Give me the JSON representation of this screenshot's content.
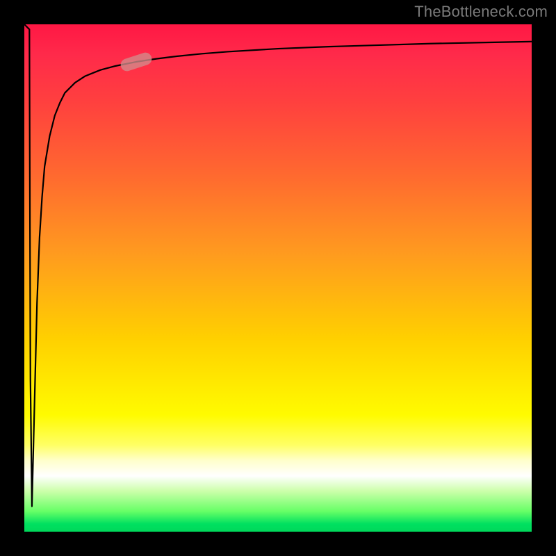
{
  "watermark": "TheBottleneck.com",
  "colors": {
    "frame": "#000000",
    "gradient_top": "#ff1744",
    "gradient_mid1": "#ff9a1f",
    "gradient_mid2": "#fffb00",
    "gradient_white": "#ffffff",
    "gradient_bottom": "#00d85a",
    "curve": "#000000",
    "marker": "rgba(210,140,140,0.78)"
  },
  "chart_data": {
    "type": "line",
    "title": "",
    "xlabel": "",
    "ylabel": "",
    "xlim": [
      0,
      100
    ],
    "ylim": [
      0,
      100
    ],
    "grid": false,
    "legend": false,
    "series": [
      {
        "name": "bottleneck-curve",
        "x": [
          0,
          1,
          1.2,
          1.5,
          2,
          2.5,
          3,
          3.5,
          4,
          5,
          6,
          7,
          8,
          10,
          12,
          15,
          18,
          22,
          26,
          30,
          35,
          40,
          50,
          60,
          70,
          80,
          90,
          100
        ],
        "y": [
          100,
          99,
          30,
          5,
          25,
          45,
          58,
          66,
          72,
          78,
          82,
          84.5,
          86.5,
          88.5,
          89.8,
          91,
          91.8,
          92.6,
          93.2,
          93.7,
          94.2,
          94.6,
          95.2,
          95.6,
          95.9,
          96.2,
          96.4,
          96.6
        ]
      }
    ],
    "annotations": [
      {
        "name": "highlight-marker",
        "x": 22,
        "y": 92.6,
        "shape": "pill",
        "angle_deg": -18
      }
    ]
  }
}
